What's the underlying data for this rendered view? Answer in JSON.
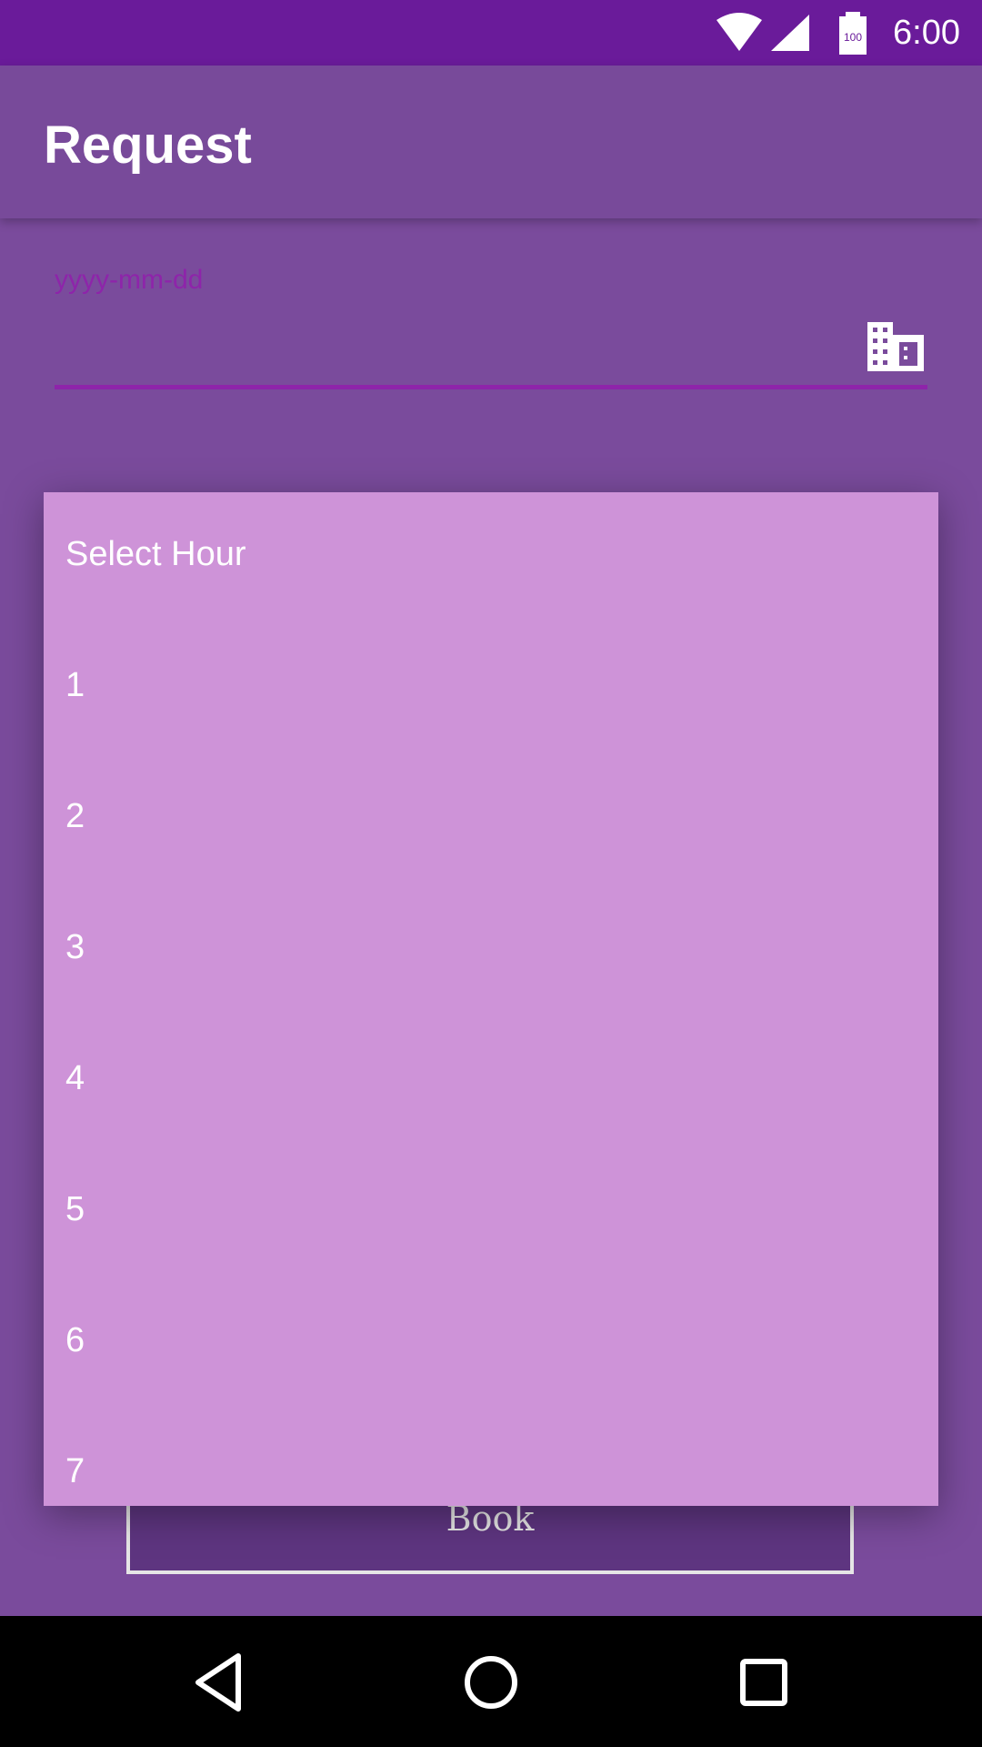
{
  "status_bar": {
    "time": "6:00",
    "battery_text": "100"
  },
  "app_bar": {
    "title": "Request"
  },
  "date_field": {
    "placeholder": "yyyy-mm-dd"
  },
  "book_button": {
    "label": "Book"
  },
  "hour_picker": {
    "title": "Select Hour",
    "options": [
      "1",
      "2",
      "3",
      "4",
      "5",
      "6",
      "7"
    ]
  },
  "colors": {
    "status_bar": "#6a1b9a",
    "app_bar": "#784a9a",
    "accent": "#8e24aa",
    "popup": "#ce93d8"
  }
}
